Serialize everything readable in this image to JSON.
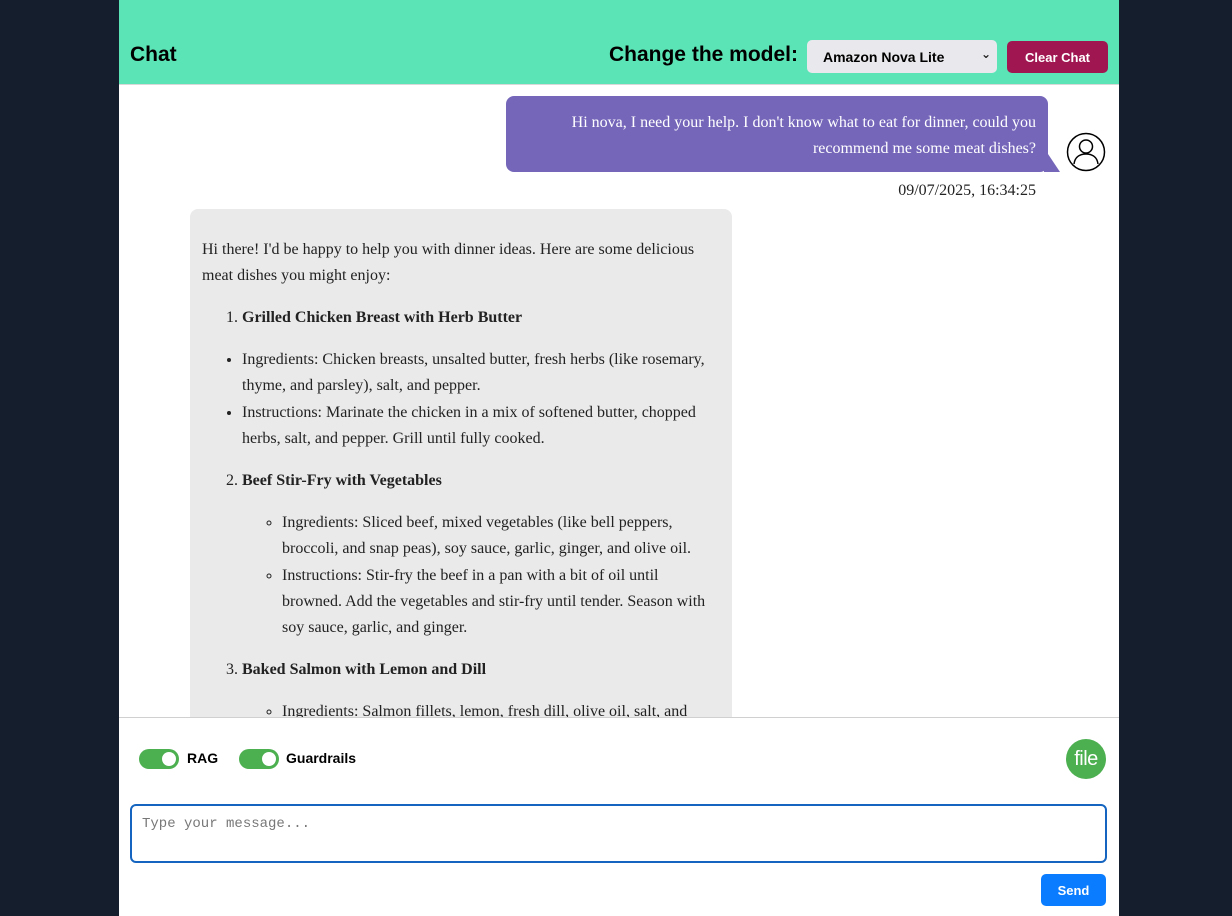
{
  "header": {
    "title": "Chat",
    "model_label": "Change the model:",
    "model_selected": "Amazon Nova Lite",
    "clear_label": "Clear Chat",
    "background_color": "#5be4b6",
    "clear_color": "#a01650"
  },
  "messages": {
    "user": {
      "text": "Hi nova, I need your help. I don't know what to eat for dinner, could you recommend me some meat dishes?",
      "timestamp": "09/07/2025, 16:34:25",
      "bubble_color": "#7566ba",
      "avatar_icon": "user-circle-icon"
    },
    "assistant": {
      "intro": "Hi there! I'd be happy to help you with dinner ideas. Here are some delicious meat dishes you might enjoy:",
      "dishes": [
        {
          "name": "Grilled Chicken Breast with Herb Butter",
          "ingredients": "Ingredients: Chicken breasts, unsalted butter, fresh herbs (like rosemary, thyme, and parsley), salt, and pepper.",
          "instructions": "Instructions: Marinate the chicken in a mix of softened butter, chopped herbs, salt, and pepper. Grill until fully cooked."
        },
        {
          "name": "Beef Stir-Fry with Vegetables",
          "ingredients": "Ingredients: Sliced beef, mixed vegetables (like bell peppers, broccoli, and snap peas), soy sauce, garlic, ginger, and olive oil.",
          "instructions": "Instructions: Stir-fry the beef in a pan with a bit of oil until browned. Add the vegetables and stir-fry until tender. Season with soy sauce, garlic, and ginger."
        },
        {
          "name": "Baked Salmon with Lemon and Dill",
          "ingredients": "Ingredients: Salmon fillets, lemon, fresh dill, olive oil, salt, and"
        }
      ]
    }
  },
  "controls": {
    "rag_label": "RAG",
    "rag_on": true,
    "guardrails_label": "Guardrails",
    "guardrails_on": true,
    "file_label": "file",
    "input_placeholder": "Type your message...",
    "send_label": "Send",
    "toggle_color": "#4caf50",
    "send_color": "#0a7cff"
  }
}
